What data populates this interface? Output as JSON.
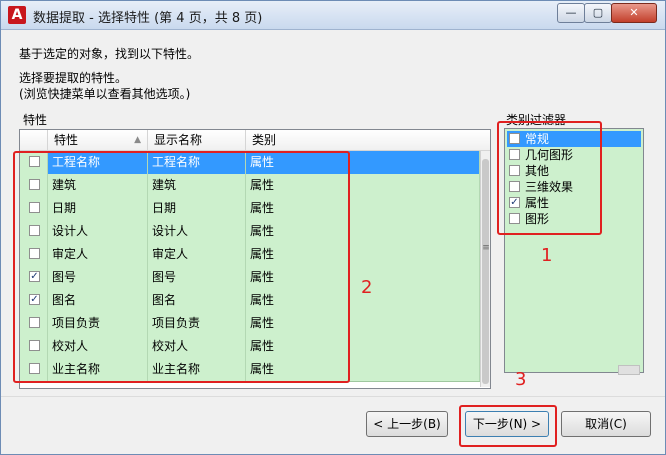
{
  "window": {
    "title": "数据提取 - 选择特性 (第 4 页，共 8 页)",
    "app_icon_letter": "A",
    "controls": {
      "minimize": "—",
      "maximize": "▢",
      "close": "✕"
    }
  },
  "intro": {
    "line1": "基于选定的对象，找到以下特性。",
    "line2": "选择要提取的特性。",
    "line3": "(浏览快捷菜单以查看其他选项。)"
  },
  "properties": {
    "group_label": "特性",
    "columns": [
      "特性",
      "显示名称",
      "类别"
    ],
    "sort_arrow": "▲",
    "rows": [
      {
        "checked": false,
        "name": "工程名称",
        "display": "工程名称",
        "category": "属性",
        "selected": true
      },
      {
        "checked": false,
        "name": "建筑",
        "display": "建筑",
        "category": "属性"
      },
      {
        "checked": false,
        "name": "日期",
        "display": "日期",
        "category": "属性"
      },
      {
        "checked": false,
        "name": "设计人",
        "display": "设计人",
        "category": "属性"
      },
      {
        "checked": false,
        "name": "审定人",
        "display": "审定人",
        "category": "属性"
      },
      {
        "checked": true,
        "name": "图号",
        "display": "图号",
        "category": "属性"
      },
      {
        "checked": true,
        "name": "图名",
        "display": "图名",
        "category": "属性"
      },
      {
        "checked": false,
        "name": "项目负责",
        "display": "项目负责",
        "category": "属性"
      },
      {
        "checked": false,
        "name": "校对人",
        "display": "校对人",
        "category": "属性"
      },
      {
        "checked": false,
        "name": "业主名称",
        "display": "业主名称",
        "category": "属性"
      }
    ],
    "scroll_grip": "≡"
  },
  "category_filter": {
    "label": "类别过滤器",
    "items": [
      {
        "label": "常规",
        "checked": false,
        "selected": true
      },
      {
        "label": "几何图形",
        "checked": false
      },
      {
        "label": "其他",
        "checked": false
      },
      {
        "label": "三维效果",
        "checked": false
      },
      {
        "label": "属性",
        "checked": true
      },
      {
        "label": "图形",
        "checked": false
      }
    ]
  },
  "buttons": {
    "back": "< 上一步(B)",
    "next": "下一步(N) >",
    "cancel": "取消(C)"
  },
  "annotations": {
    "box1": "1",
    "box2": "2",
    "box3": "3"
  },
  "colors": {
    "row_bg": "#cdf0cd",
    "selection": "#3399ff",
    "annotation": "#e02020",
    "close_button": "#c2402c"
  }
}
